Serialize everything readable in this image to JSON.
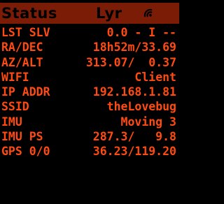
{
  "header": {
    "tabs": [
      {
        "label": "Status"
      },
      {
        "label": "Lyr"
      }
    ],
    "wifi_icon": "wifi-icon"
  },
  "colors": {
    "text": "#ff4a12",
    "header_bg": "#7a1c06",
    "background": "#000000"
  },
  "rows": [
    {
      "label": "LST SLV",
      "value": "0.0 - I --"
    },
    {
      "label": "RA/DEC",
      "value": "18h52m/33.69"
    },
    {
      "label": "AZ/ALT",
      "value": "313.07/  0.37"
    },
    {
      "label": "WIFI",
      "value": "Client"
    },
    {
      "label": "IP ADDR",
      "value": "192.168.1.81"
    },
    {
      "label": "SSID",
      "value": "theLovebug"
    },
    {
      "label": "IMU",
      "value": "Moving 3"
    },
    {
      "label": "IMU PS",
      "value": "287.3/   9.8"
    },
    {
      "label": "GPS 0/0",
      "value": "36.23/119.20"
    }
  ]
}
